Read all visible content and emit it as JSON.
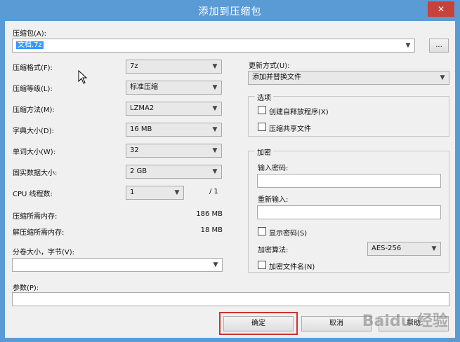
{
  "window": {
    "title": "添加到压缩包",
    "close_glyph": "✕"
  },
  "archive": {
    "label": "压缩包(A):",
    "value": "文档.7z",
    "browse_label": "..."
  },
  "format": {
    "label": "压缩格式(F):",
    "value": "7z"
  },
  "level": {
    "label": "压缩等级(L):",
    "value": "标准压缩"
  },
  "method": {
    "label": "压缩方法(M):",
    "value": "LZMA2"
  },
  "dict": {
    "label": "字典大小(D):",
    "value": "16 MB"
  },
  "word": {
    "label": "单词大小(W):",
    "value": "32"
  },
  "solid": {
    "label": "固实数据大小:",
    "value": "2 GB"
  },
  "cpu": {
    "label": "CPU 线程数:",
    "value": "1",
    "total": "/ 1"
  },
  "memory": {
    "compress_label": "压缩所需内存:",
    "compress_value": "186 MB",
    "decompress_label": "解压缩所需内存:",
    "decompress_value": "18 MB"
  },
  "split": {
    "label": "分卷大小，字节(V):",
    "value": ""
  },
  "params": {
    "label": "参数(P):",
    "value": ""
  },
  "update": {
    "label": "更新方式(U):",
    "value": "添加并替换文件"
  },
  "options": {
    "title": "选项",
    "sfx_label": "创建自释放程序(X)",
    "shared_label": "压缩共享文件"
  },
  "encryption": {
    "title": "加密",
    "password_label": "输入密码:",
    "reenter_label": "重新输入:",
    "show_label": "显示密码(S)",
    "method_label": "加密算法:",
    "method_value": "AES-256",
    "encrypt_names_label": "加密文件名(N)"
  },
  "buttons": {
    "ok": "确定",
    "cancel": "取消",
    "help": "帮助"
  },
  "watermark": "Baidu 经验",
  "icons": {
    "dropdown": "chevron-down-icon",
    "cursor": "mouse-cursor-icon"
  }
}
